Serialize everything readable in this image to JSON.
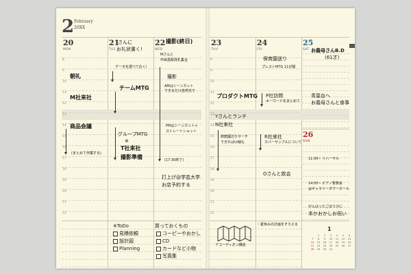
{
  "header": {
    "month": "2",
    "month_name": "February",
    "year": "20XX"
  },
  "hours": [
    "8",
    "9",
    "10",
    "11",
    "12",
    "13",
    "14",
    "15",
    "16",
    "17",
    "18",
    "19",
    "20",
    "21",
    "22"
  ],
  "days": [
    {
      "num": "20",
      "label": "MON"
    },
    {
      "num": "21",
      "label": "TUE"
    },
    {
      "num": "22",
      "label": "WED"
    },
    {
      "num": "23",
      "label": "THU"
    },
    {
      "num": "24",
      "label": "FRI"
    },
    {
      "num": "25",
      "label": "SAT"
    },
    {
      "num": "26",
      "label": "SUN"
    }
  ],
  "notes": {
    "d21_top": "Iさんに",
    "d21_top2": "お礼状書く!",
    "d21_data": "データを調べておく!",
    "d21_team": "チームMTG",
    "d21_group": "グループMTG",
    "d21_mark": "※",
    "d21_tco": "T社来社",
    "d21_shoot": "撮影準備",
    "d20_asa": "朝礼",
    "d20_m": "M社来社",
    "d20_shohin": "商品会議",
    "d20_matome": "(まとめて作業する)",
    "d22_title": "撮影(終日)",
    "d22_m1": "Mさんと",
    "d22_m2": "中目黒駅改札集合",
    "d22_satsuei": "撮影",
    "d22_am1": "AMはシーンカット",
    "d22_am2": "できるだけ自然光で",
    "d22_pm1": "PMはシーンカット+",
    "d22_pm2": "ストレートショット",
    "d22_end": "(17:30終了)",
    "d22_uchi1": "打上げ@学芸大学",
    "d22_uchi2": "お店予約する",
    "d23_product": "プロダクトMTG",
    "d23_lunch": "Yさんとランチ",
    "d23_nco": "N社来社",
    "d23_s1": "修磨園辺りサーチ",
    "d23_s2": "できればUI様も",
    "d24_hoken": "保育園送り",
    "d24_press": "プレストMTG 11が開",
    "d24_p": "P社訪問",
    "d24_p2": "キーワードをまとめて",
    "d24_r": "R社来社",
    "d24_r2": "カバーサンプルについて",
    "d24_o": "Oさんと飲会",
    "d25_bday1": "お義母さんB.D",
    "d25_bday2": "(61才)",
    "d25_s1": "青葉台へ",
    "d25_s2": "お義母さんと食事",
    "d26_r": "11:00~ リハーサル",
    "d26_p1": "14:00~ ピアノ発表会",
    "d26_p2": "@ギャラリータワーホール",
    "d26_p3": "がんばったごほうびに",
    "d26_p4": "本かおかしお祝い",
    "todo_title": "※ToDo",
    "todo": [
      "見積依頼",
      "設計図",
      "Planning"
    ],
    "shop_title": "買っておくもの",
    "shop": [
      "コーピーやおかし",
      "CD",
      "カードなど小物",
      "写真集"
    ],
    "accordion": "アコーディオン構造",
    "vacation": "・夏休みの計画をそろえる",
    "cal_month": "1",
    "cal_days": [
      "",
      "1",
      "2",
      "3",
      "4",
      "5",
      "6",
      "7",
      "8",
      "9",
      "10",
      "11",
      "12",
      "13",
      "14",
      "15",
      "16",
      "17",
      "18",
      "19",
      "20",
      "21",
      "22",
      "23",
      "24",
      "25",
      "26",
      "27",
      "28",
      "29",
      "30",
      "31"
    ]
  }
}
